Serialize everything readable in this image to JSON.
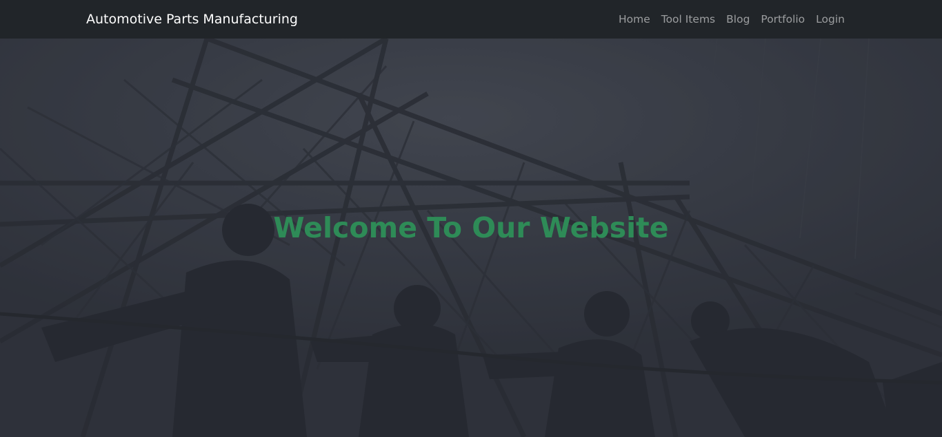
{
  "navbar": {
    "brand": "Automotive Parts Manufacturing",
    "links": [
      {
        "label": "Home"
      },
      {
        "label": "Tool Items"
      },
      {
        "label": "Blog"
      },
      {
        "label": "Portfolio"
      },
      {
        "label": "Login"
      }
    ]
  },
  "hero": {
    "headline": "Welcome To Our Website",
    "background_image": "silhouette of workers pulling rope under steel transmission tower",
    "headline_color": "#2e8b57"
  },
  "colors": {
    "navbar_bg": "#212529",
    "brand_text": "#ffffff",
    "nav_link": "#8c8f93",
    "hero_overlay": "#3b3f48"
  }
}
